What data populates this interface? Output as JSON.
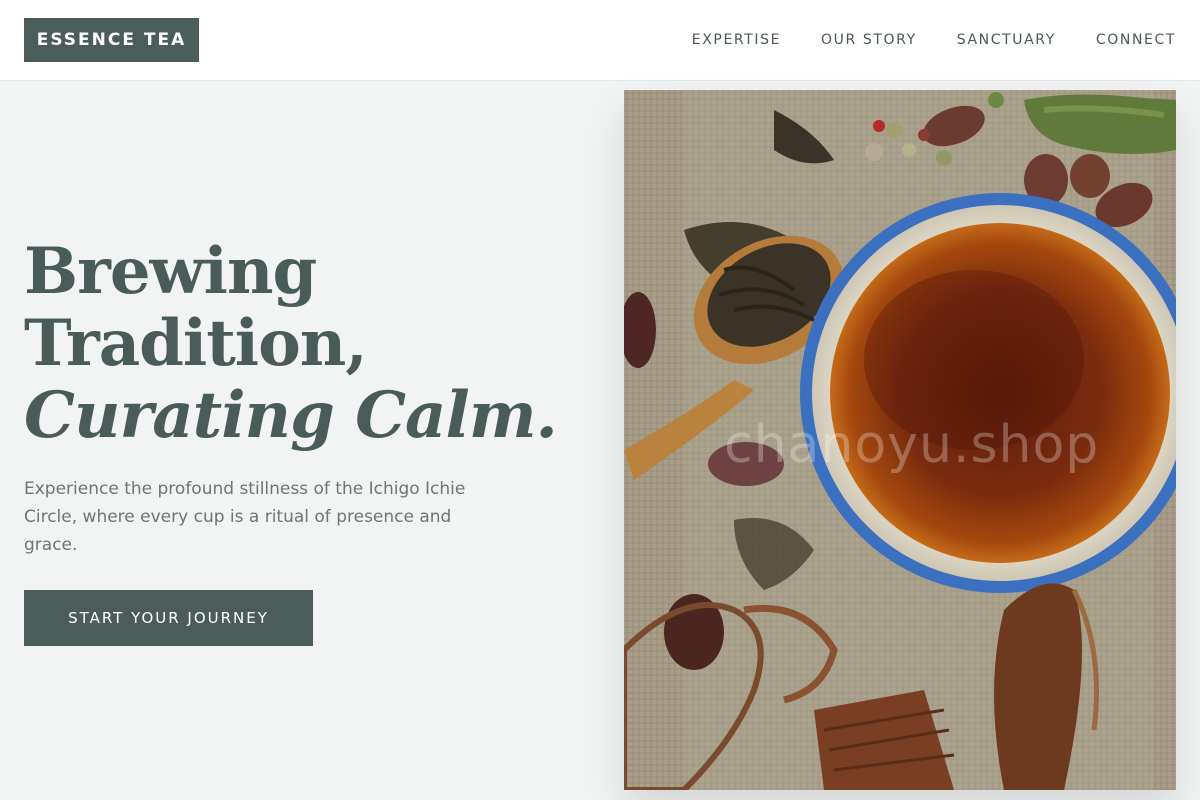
{
  "header": {
    "logo": "ESSENCE TEA",
    "nav": [
      {
        "label": "EXPERTISE"
      },
      {
        "label": "OUR STORY"
      },
      {
        "label": "SANCTUARY"
      },
      {
        "label": "CONNECT"
      }
    ]
  },
  "hero": {
    "headline_line1": "Brewing",
    "headline_line2": "Tradition,",
    "headline_line3": "Curating Calm.",
    "description": "Experience the profound stillness of the Ichigo Ichie Circle, where every cup is a ritual of presence and grace.",
    "cta_label": "START YOUR JOURNEY"
  },
  "image": {
    "watermark": "chanoyu.shop",
    "subject": "tea-bowl-with-loose-leaf-and-spices"
  },
  "colors": {
    "accent": "#4b5d5b",
    "background": "#f2f4f3",
    "header_bg": "#ffffff",
    "text_muted": "#6a7775"
  }
}
